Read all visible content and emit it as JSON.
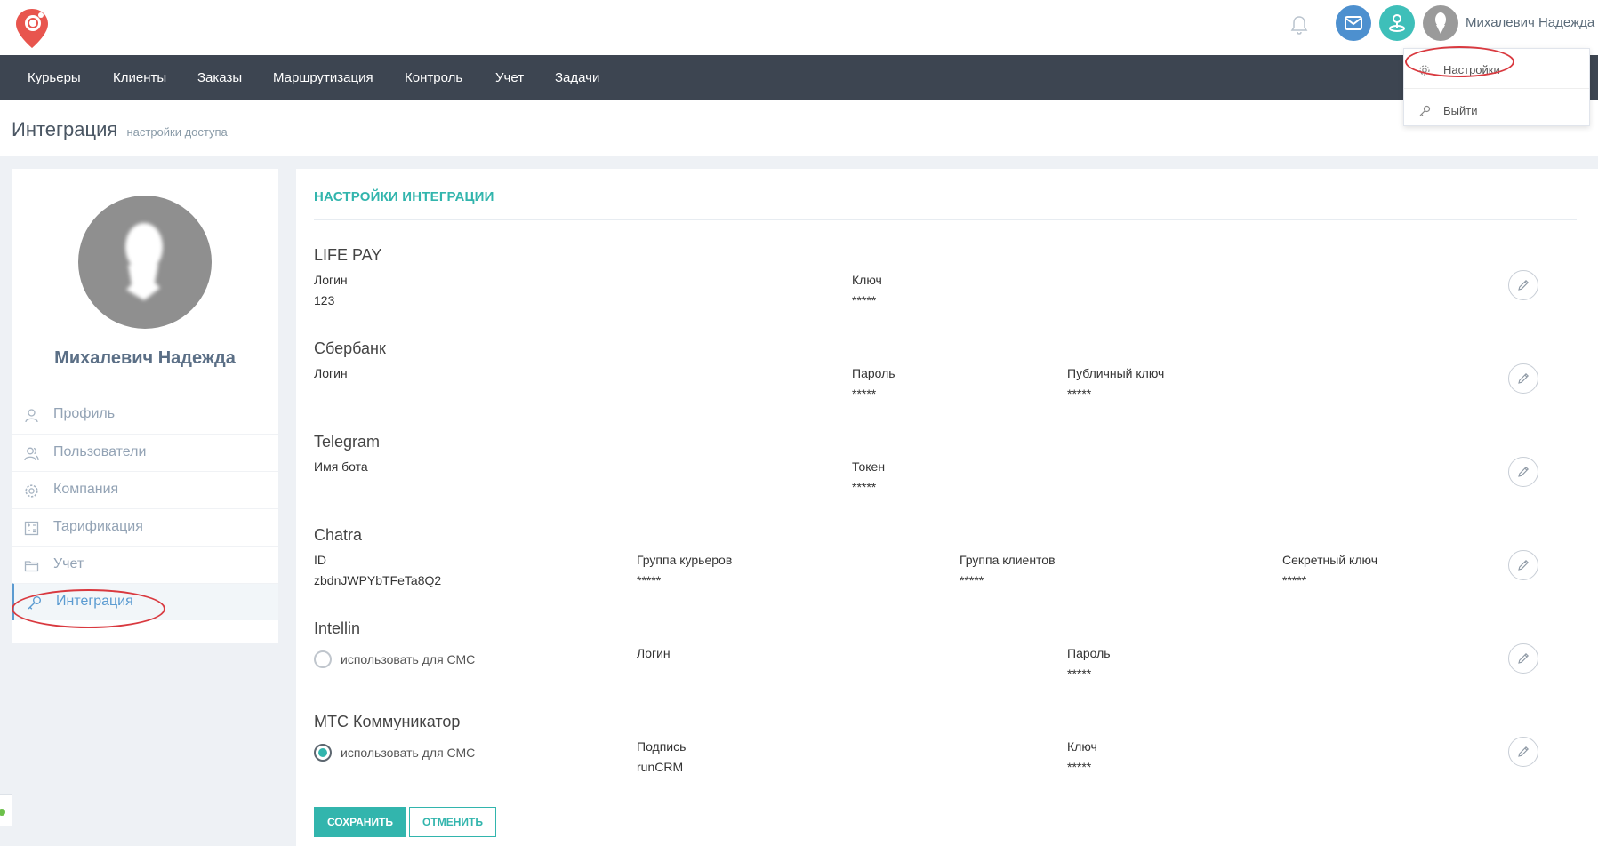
{
  "header": {
    "user_name": "Михалевич Надежда",
    "colors": {
      "mail": "#4d90cf",
      "geo": "#3ebfb9",
      "logo": "#e8554e"
    }
  },
  "user_menu": {
    "settings_label": "Настройки",
    "logout_label": "Выйти"
  },
  "nav": {
    "items": [
      "Курьеры",
      "Клиенты",
      "Заказы",
      "Маршрутизация",
      "Контроль",
      "Учет",
      "Задачи"
    ]
  },
  "page": {
    "title": "Интеграция",
    "subtitle": "настройки доступа"
  },
  "sidebar": {
    "profile_name": "Михалевич Надежда",
    "items": [
      {
        "label": "Профиль",
        "icon": "user-icon"
      },
      {
        "label": "Пользователи",
        "icon": "users-icon"
      },
      {
        "label": "Компания",
        "icon": "gear-icon"
      },
      {
        "label": "Тарификация",
        "icon": "calculator-icon"
      },
      {
        "label": "Учет",
        "icon": "folder-icon"
      },
      {
        "label": "Интеграция",
        "icon": "key-icon"
      }
    ]
  },
  "main": {
    "section_title": "НАСТРОЙКИ ИНТЕГРАЦИИ",
    "lifepay": {
      "name": "LIFE PAY",
      "login_label": "Логин",
      "login_value": "123",
      "key_label": "Ключ",
      "key_value": "*****"
    },
    "sberbank": {
      "name": "Сбербанк",
      "login_label": "Логин",
      "password_label": "Пароль",
      "password_value": "*****",
      "public_key_label": "Публичный ключ",
      "public_key_value": "*****"
    },
    "telegram": {
      "name": "Telegram",
      "bot_label": "Имя бота",
      "token_label": "Токен",
      "token_value": "*****"
    },
    "chatra": {
      "name": "Chatra",
      "id_label": "ID",
      "id_value": "zbdnJWPYbTFeTa8Q2",
      "couriers_label": "Группа курьеров",
      "couriers_value": "*****",
      "clients_label": "Группа клиентов",
      "clients_value": "*****",
      "secret_label": "Секретный ключ",
      "secret_value": "*****"
    },
    "intellin": {
      "name": "Intellin",
      "sms_label": "использовать для СМС",
      "login_label": "Логин",
      "password_label": "Пароль",
      "password_value": "*****"
    },
    "mts": {
      "name": "МТС Коммуникатор",
      "sms_label": "использовать для СМС",
      "signature_label": "Подпись",
      "signature_value": "runCRM",
      "key_label": "Ключ",
      "key_value": "*****"
    },
    "save_label": "СОХРАНИТЬ",
    "cancel_label": "ОТМЕНИТЬ"
  }
}
